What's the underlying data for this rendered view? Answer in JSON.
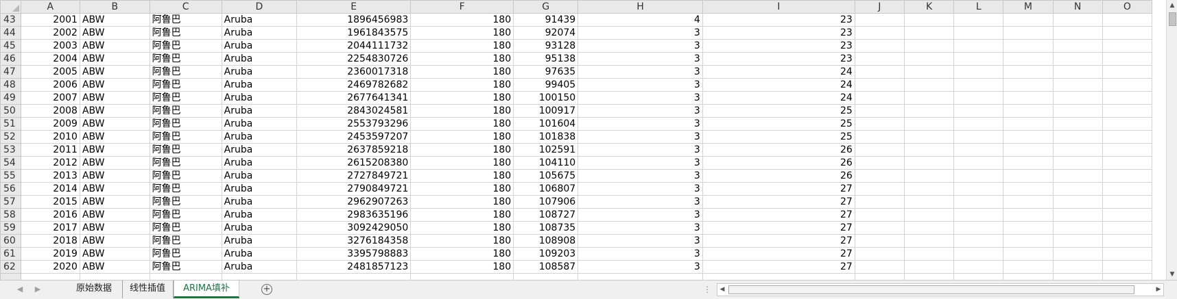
{
  "columns": [
    "A",
    "B",
    "C",
    "D",
    "E",
    "F",
    "G",
    "H",
    "I",
    "J",
    "K",
    "L",
    "M",
    "N",
    "O"
  ],
  "rows": [
    {
      "row": "43",
      "a": "2001",
      "b": "ABW",
      "c": "阿鲁巴",
      "d": "Aruba",
      "e": "1896456983",
      "f": "180",
      "g": "91439",
      "h": "4",
      "i": "23"
    },
    {
      "row": "44",
      "a": "2002",
      "b": "ABW",
      "c": "阿鲁巴",
      "d": "Aruba",
      "e": "1961843575",
      "f": "180",
      "g": "92074",
      "h": "3",
      "i": "23"
    },
    {
      "row": "45",
      "a": "2003",
      "b": "ABW",
      "c": "阿鲁巴",
      "d": "Aruba",
      "e": "2044111732",
      "f": "180",
      "g": "93128",
      "h": "3",
      "i": "23"
    },
    {
      "row": "46",
      "a": "2004",
      "b": "ABW",
      "c": "阿鲁巴",
      "d": "Aruba",
      "e": "2254830726",
      "f": "180",
      "g": "95138",
      "h": "3",
      "i": "23"
    },
    {
      "row": "47",
      "a": "2005",
      "b": "ABW",
      "c": "阿鲁巴",
      "d": "Aruba",
      "e": "2360017318",
      "f": "180",
      "g": "97635",
      "h": "3",
      "i": "24"
    },
    {
      "row": "48",
      "a": "2006",
      "b": "ABW",
      "c": "阿鲁巴",
      "d": "Aruba",
      "e": "2469782682",
      "f": "180",
      "g": "99405",
      "h": "3",
      "i": "24"
    },
    {
      "row": "49",
      "a": "2007",
      "b": "ABW",
      "c": "阿鲁巴",
      "d": "Aruba",
      "e": "2677641341",
      "f": "180",
      "g": "100150",
      "h": "3",
      "i": "24"
    },
    {
      "row": "50",
      "a": "2008",
      "b": "ABW",
      "c": "阿鲁巴",
      "d": "Aruba",
      "e": "2843024581",
      "f": "180",
      "g": "100917",
      "h": "3",
      "i": "25"
    },
    {
      "row": "51",
      "a": "2009",
      "b": "ABW",
      "c": "阿鲁巴",
      "d": "Aruba",
      "e": "2553793296",
      "f": "180",
      "g": "101604",
      "h": "3",
      "i": "25"
    },
    {
      "row": "52",
      "a": "2010",
      "b": "ABW",
      "c": "阿鲁巴",
      "d": "Aruba",
      "e": "2453597207",
      "f": "180",
      "g": "101838",
      "h": "3",
      "i": "25"
    },
    {
      "row": "53",
      "a": "2011",
      "b": "ABW",
      "c": "阿鲁巴",
      "d": "Aruba",
      "e": "2637859218",
      "f": "180",
      "g": "102591",
      "h": "3",
      "i": "26"
    },
    {
      "row": "54",
      "a": "2012",
      "b": "ABW",
      "c": "阿鲁巴",
      "d": "Aruba",
      "e": "2615208380",
      "f": "180",
      "g": "104110",
      "h": "3",
      "i": "26"
    },
    {
      "row": "55",
      "a": "2013",
      "b": "ABW",
      "c": "阿鲁巴",
      "d": "Aruba",
      "e": "2727849721",
      "f": "180",
      "g": "105675",
      "h": "3",
      "i": "26"
    },
    {
      "row": "56",
      "a": "2014",
      "b": "ABW",
      "c": "阿鲁巴",
      "d": "Aruba",
      "e": "2790849721",
      "f": "180",
      "g": "106807",
      "h": "3",
      "i": "27"
    },
    {
      "row": "57",
      "a": "2015",
      "b": "ABW",
      "c": "阿鲁巴",
      "d": "Aruba",
      "e": "2962907263",
      "f": "180",
      "g": "107906",
      "h": "3",
      "i": "27"
    },
    {
      "row": "58",
      "a": "2016",
      "b": "ABW",
      "c": "阿鲁巴",
      "d": "Aruba",
      "e": "2983635196",
      "f": "180",
      "g": "108727",
      "h": "3",
      "i": "27"
    },
    {
      "row": "59",
      "a": "2017",
      "b": "ABW",
      "c": "阿鲁巴",
      "d": "Aruba",
      "e": "3092429050",
      "f": "180",
      "g": "108735",
      "h": "3",
      "i": "27"
    },
    {
      "row": "60",
      "a": "2018",
      "b": "ABW",
      "c": "阿鲁巴",
      "d": "Aruba",
      "e": "3276184358",
      "f": "180",
      "g": "108908",
      "h": "3",
      "i": "27"
    },
    {
      "row": "61",
      "a": "2019",
      "b": "ABW",
      "c": "阿鲁巴",
      "d": "Aruba",
      "e": "3395798883",
      "f": "180",
      "g": "109203",
      "h": "3",
      "i": "27"
    },
    {
      "row": "62",
      "a": "2020",
      "b": "ABW",
      "c": "阿鲁巴",
      "d": "Aruba",
      "e": "2481857123",
      "f": "180",
      "g": "108587",
      "h": "3",
      "i": "27"
    }
  ],
  "tabs": {
    "sheet1": "原始数据",
    "sheet2": "线性插值",
    "sheet3": "ARIMA填补",
    "active": "ARIMA填补"
  },
  "icons": {
    "add_sheet": "plus-circle-icon",
    "tab_nav_prev": "triangle-left-icon",
    "tab_nav_next": "triangle-right-icon",
    "scroll_up": "triangle-up-icon",
    "scroll_down": "triangle-down-icon",
    "scroll_left": "triangle-left-icon",
    "scroll_right": "triangle-right-icon"
  },
  "colors": {
    "active_tab": "#217346",
    "header_bg": "#e9e9e9",
    "gridline": "#d4d4d4"
  }
}
